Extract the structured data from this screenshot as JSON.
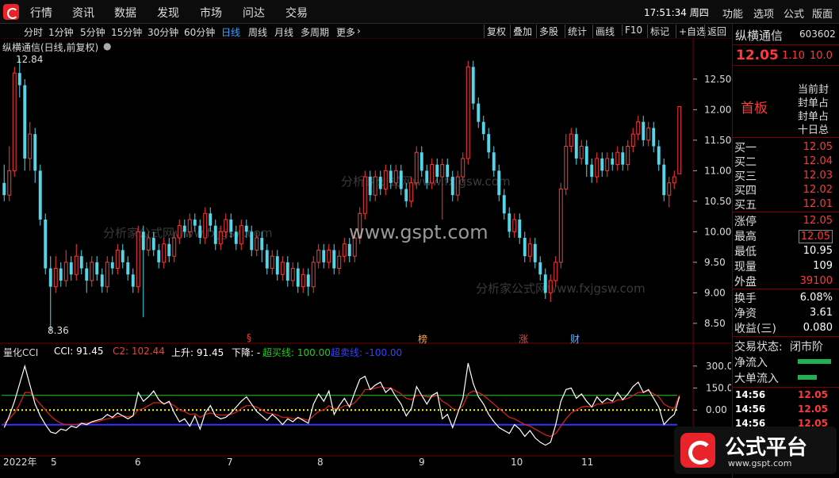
{
  "topbar": {
    "menus": [
      "行情",
      "资讯",
      "数据",
      "发现",
      "市场",
      "问达",
      "交易"
    ],
    "clock": "17:51:34 周四",
    "right_menus": [
      "功能",
      "选项",
      "公式",
      "版面"
    ]
  },
  "toolbar": {
    "periods": [
      "分时",
      "1分钟",
      "5分钟",
      "15分钟",
      "30分钟",
      "60分钟",
      "日线",
      "周线",
      "月线",
      "多周期",
      "更多"
    ],
    "active_period": "日线",
    "right_items": [
      "复权",
      "叠加",
      "多股",
      "统计",
      "画线",
      "F10",
      "标记",
      "+自选",
      "返回"
    ]
  },
  "main_chart": {
    "title": "纵横通信(日线,前复权)",
    "high_marker": "12.84",
    "low_marker": "8.36",
    "y_ticks": [
      "12.50",
      "12.00",
      "11.50",
      "11.00",
      "10.50",
      "10.00",
      "9.50",
      "9.00",
      "8.50"
    ],
    "event_tags": [
      "§",
      "榜",
      "涨",
      "财"
    ],
    "watermark": "www.gspt.com",
    "bg_watermark": "分析家公式网www.fxjgsw.com"
  },
  "indicator": {
    "name": "量化CCI",
    "cci_label": "CCI: 91.45",
    "c2_label": "C2: 102.44",
    "up_label": "上升: 91.45",
    "down_label": "下降: -",
    "overbuy_label": "超买线: 100.00",
    "oversell_label": "超卖线: -100.00",
    "y_ticks": [
      "300.0",
      "150.0",
      "0.00"
    ]
  },
  "x_axis": {
    "labels": [
      "2022年",
      "5",
      "6",
      "7",
      "8",
      "9",
      "10",
      "11"
    ]
  },
  "right_panel": {
    "stock_name": "纵横通信",
    "stock_code": "603602",
    "price": "12.05",
    "change": "1.10",
    "pct": "10.0",
    "tag": "首板",
    "notes": [
      "当前封",
      "封单占",
      "封单占",
      "十日总"
    ],
    "bids": [
      {
        "label": "买一",
        "value": "12.05"
      },
      {
        "label": "买二",
        "value": "12.04"
      },
      {
        "label": "买三",
        "value": "12.03"
      },
      {
        "label": "买四",
        "value": "12.02"
      },
      {
        "label": "买五",
        "value": "12.01"
      }
    ],
    "stats": [
      {
        "label": "涨停",
        "value": "12.05"
      },
      {
        "label": "最高",
        "value": "12.05"
      },
      {
        "label": "最低",
        "value": "10.95"
      },
      {
        "label": "现量",
        "value": "109"
      },
      {
        "label": "外盘",
        "value": "39100"
      }
    ],
    "stats2": [
      {
        "label": "换手",
        "value": "6.08%"
      },
      {
        "label": "净资",
        "value": "3.61"
      },
      {
        "label": "收益(三)",
        "value": "0.080"
      }
    ],
    "trade_status_label": "交易状态:",
    "trade_status": "闭市阶",
    "net_inflow": "净流入",
    "big_inflow": "大单流入",
    "ticks": [
      {
        "time": "14:56",
        "price": "12.05"
      },
      {
        "time": "14:56",
        "price": "12.05"
      },
      {
        "time": "14:56",
        "price": "12.05"
      }
    ]
  },
  "badge": {
    "title": "公式平台",
    "url": "www.gspt.com"
  },
  "colors": {
    "up": "#ff3a3a",
    "down": "#54d6e8",
    "cci": "#ffffff",
    "c2": "#e02020",
    "overbuy": "#22cc22",
    "oversell": "#3333ff",
    "zero": "#ffff00"
  },
  "chart_data": {
    "type": "candlestick",
    "title": "纵横通信(日线,前复权)",
    "ylim": [
      8.2,
      12.9
    ],
    "candles": [
      [
        10.8,
        10.6,
        11.1,
        10.5
      ],
      [
        10.6,
        11.0,
        11.4,
        10.5
      ],
      [
        11.0,
        12.6,
        12.7,
        10.9
      ],
      [
        12.6,
        12.4,
        12.84,
        12.2
      ],
      [
        12.4,
        11.2,
        12.5,
        11.0
      ],
      [
        11.2,
        11.6,
        11.8,
        11.0
      ],
      [
        11.6,
        11.0,
        11.7,
        10.8
      ],
      [
        11.0,
        10.2,
        11.1,
        10.1
      ],
      [
        10.2,
        9.4,
        10.3,
        9.3
      ],
      [
        9.4,
        9.1,
        9.6,
        8.36
      ],
      [
        9.1,
        9.4,
        9.6,
        9.0
      ],
      [
        9.4,
        9.2,
        9.5,
        9.1
      ],
      [
        9.2,
        9.5,
        9.7,
        9.1
      ],
      [
        9.5,
        9.3,
        9.6,
        9.2
      ],
      [
        9.3,
        9.6,
        9.8,
        9.2
      ],
      [
        9.6,
        9.4,
        9.7,
        9.3
      ],
      [
        9.4,
        9.2,
        9.5,
        9.0
      ],
      [
        9.2,
        9.5,
        9.6,
        9.1
      ],
      [
        9.5,
        9.3,
        9.6,
        9.2
      ],
      [
        9.3,
        9.1,
        9.4,
        9.0
      ],
      [
        9.1,
        9.5,
        9.6,
        9.0
      ],
      [
        9.5,
        9.4,
        9.6,
        9.3
      ],
      [
        9.4,
        9.7,
        9.8,
        9.3
      ],
      [
        9.7,
        9.5,
        9.8,
        9.4
      ],
      [
        9.5,
        9.3,
        9.6,
        9.2
      ],
      [
        9.3,
        9.1,
        9.4,
        9.0
      ],
      [
        9.1,
        10.0,
        10.1,
        9.0
      ],
      [
        10.0,
        9.7,
        10.1,
        8.6
      ],
      [
        9.7,
        9.9,
        10.0,
        9.6
      ],
      [
        9.9,
        9.7,
        10.0,
        9.6
      ],
      [
        9.7,
        9.5,
        9.8,
        9.4
      ],
      [
        9.5,
        9.8,
        9.9,
        9.4
      ],
      [
        9.8,
        9.6,
        9.9,
        9.5
      ],
      [
        9.6,
        9.9,
        10.0,
        9.5
      ],
      [
        9.9,
        10.1,
        10.2,
        9.8
      ],
      [
        10.1,
        10.0,
        10.2,
        9.9
      ],
      [
        10.0,
        10.2,
        10.3,
        9.9
      ],
      [
        10.2,
        10.1,
        10.3,
        10.0
      ],
      [
        10.1,
        9.9,
        10.2,
        9.8
      ],
      [
        9.9,
        10.3,
        10.4,
        9.8
      ],
      [
        10.3,
        10.1,
        10.4,
        10.0
      ],
      [
        10.1,
        9.8,
        10.2,
        9.7
      ],
      [
        9.8,
        10.0,
        10.1,
        9.7
      ],
      [
        10.0,
        10.2,
        10.3,
        9.9
      ],
      [
        10.2,
        10.0,
        10.3,
        9.9
      ],
      [
        10.0,
        9.8,
        10.1,
        9.7
      ],
      [
        9.8,
        10.1,
        10.2,
        9.7
      ],
      [
        10.1,
        10.0,
        10.2,
        9.9
      ],
      [
        10.0,
        9.7,
        10.1,
        9.6
      ],
      [
        9.7,
        9.9,
        10.0,
        9.6
      ],
      [
        9.9,
        9.7,
        10.0,
        9.5
      ],
      [
        9.7,
        9.4,
        9.8,
        9.3
      ],
      [
        9.4,
        9.6,
        9.7,
        9.3
      ],
      [
        9.6,
        9.3,
        9.7,
        9.2
      ],
      [
        9.3,
        9.5,
        9.6,
        9.2
      ],
      [
        9.5,
        9.2,
        9.6,
        9.1
      ],
      [
        9.2,
        9.4,
        9.5,
        9.1
      ],
      [
        9.4,
        9.1,
        9.5,
        9.0
      ],
      [
        9.1,
        9.3,
        9.4,
        9.0
      ],
      [
        9.3,
        9.1,
        9.4,
        8.95
      ],
      [
        9.1,
        9.5,
        9.6,
        9.0
      ],
      [
        9.5,
        9.7,
        9.8,
        9.4
      ],
      [
        9.7,
        9.5,
        9.8,
        9.4
      ],
      [
        9.5,
        9.7,
        9.8,
        9.4
      ],
      [
        9.7,
        9.4,
        9.8,
        9.3
      ],
      [
        9.4,
        9.6,
        9.7,
        9.3
      ],
      [
        9.6,
        9.8,
        9.9,
        9.5
      ],
      [
        9.8,
        9.6,
        9.9,
        9.5
      ],
      [
        9.6,
        9.9,
        10.0,
        9.5
      ],
      [
        9.9,
        10.3,
        10.4,
        9.8
      ],
      [
        10.3,
        10.9,
        11.0,
        10.2
      ],
      [
        10.9,
        10.6,
        11.0,
        10.5
      ],
      [
        10.6,
        10.9,
        11.0,
        10.5
      ],
      [
        10.9,
        10.7,
        11.0,
        10.6
      ],
      [
        10.7,
        11.0,
        11.1,
        10.6
      ],
      [
        11.0,
        10.8,
        11.1,
        10.7
      ],
      [
        10.8,
        11.0,
        11.1,
        10.7
      ],
      [
        11.0,
        10.7,
        11.1,
        10.6
      ],
      [
        10.7,
        10.5,
        10.8,
        10.4
      ],
      [
        10.5,
        10.8,
        10.9,
        10.4
      ],
      [
        10.8,
        11.3,
        11.4,
        10.7
      ],
      [
        11.3,
        11.0,
        11.4,
        10.9
      ],
      [
        11.0,
        10.8,
        11.1,
        10.7
      ],
      [
        10.8,
        11.1,
        11.2,
        10.7
      ],
      [
        11.1,
        10.9,
        11.2,
        10.8
      ],
      [
        10.9,
        11.1,
        11.2,
        10.2
      ],
      [
        11.1,
        10.9,
        11.2,
        10.8
      ],
      [
        10.9,
        10.6,
        11.0,
        10.5
      ],
      [
        10.6,
        10.9,
        11.0,
        10.5
      ],
      [
        10.9,
        11.2,
        11.3,
        10.8
      ],
      [
        11.2,
        12.7,
        12.8,
        11.1
      ],
      [
        12.7,
        12.1,
        12.8,
        12.0
      ],
      [
        12.1,
        11.8,
        12.2,
        11.7
      ],
      [
        11.8,
        11.6,
        11.9,
        11.5
      ],
      [
        11.6,
        11.3,
        11.7,
        11.2
      ],
      [
        11.3,
        11.0,
        11.4,
        10.9
      ],
      [
        11.0,
        10.6,
        11.1,
        10.5
      ],
      [
        10.6,
        10.3,
        10.7,
        10.2
      ],
      [
        10.3,
        10.0,
        10.4,
        9.9
      ],
      [
        10.0,
        10.2,
        10.3,
        9.9
      ],
      [
        10.2,
        9.9,
        10.3,
        9.8
      ],
      [
        9.9,
        9.6,
        10.0,
        9.5
      ],
      [
        9.6,
        9.8,
        9.9,
        9.5
      ],
      [
        9.8,
        9.5,
        9.9,
        9.4
      ],
      [
        9.5,
        9.3,
        9.6,
        9.2
      ],
      [
        9.3,
        9.0,
        9.4,
        8.9
      ],
      [
        9.0,
        9.2,
        9.3,
        8.85
      ],
      [
        9.2,
        9.5,
        9.6,
        9.1
      ],
      [
        9.5,
        10.7,
        10.8,
        9.4
      ],
      [
        10.7,
        11.4,
        11.6,
        10.6
      ],
      [
        11.4,
        11.6,
        11.7,
        11.3
      ],
      [
        11.6,
        11.2,
        11.7,
        11.1
      ],
      [
        11.2,
        11.4,
        11.5,
        11.1
      ],
      [
        11.4,
        11.1,
        11.5,
        10.9
      ],
      [
        11.1,
        10.9,
        11.2,
        10.8
      ],
      [
        10.9,
        11.2,
        11.3,
        10.8
      ],
      [
        11.2,
        11.0,
        11.3,
        10.9
      ],
      [
        11.0,
        11.2,
        11.3,
        10.9
      ],
      [
        11.2,
        11.1,
        11.3,
        11.0
      ],
      [
        11.1,
        11.3,
        11.4,
        11.0
      ],
      [
        11.3,
        11.1,
        11.4,
        11.0
      ],
      [
        11.1,
        11.4,
        11.5,
        11.0
      ],
      [
        11.4,
        11.6,
        11.7,
        11.3
      ],
      [
        11.6,
        11.8,
        11.9,
        11.5
      ],
      [
        11.8,
        11.5,
        11.9,
        11.4
      ],
      [
        11.5,
        11.7,
        11.8,
        11.4
      ],
      [
        11.7,
        11.4,
        11.8,
        11.3
      ],
      [
        11.4,
        11.1,
        11.5,
        11.0
      ],
      [
        11.1,
        10.6,
        11.2,
        10.5
      ],
      [
        10.6,
        10.8,
        10.9,
        10.4
      ],
      [
        10.8,
        10.9,
        11.0,
        10.7
      ],
      [
        10.95,
        12.05,
        12.05,
        10.95
      ]
    ],
    "indicator": {
      "name": "量化CCI",
      "ylim": [
        -280,
        380
      ],
      "overbuy": 100,
      "oversell": -100,
      "zero": 0,
      "cci": [
        -120,
        -40,
        60,
        180,
        300,
        170,
        40,
        -40,
        -100,
        -150,
        -160,
        -130,
        -140,
        -110,
        -120,
        -90,
        -100,
        -80,
        -70,
        -60,
        -30,
        -50,
        -20,
        -40,
        -60,
        -40,
        120,
        60,
        90,
        130,
        70,
        40,
        60,
        -20,
        -80,
        -60,
        -110,
        -40,
        -130,
        -20,
        30,
        -40,
        -60,
        -50,
        -20,
        20,
        60,
        90,
        40,
        -10,
        -40,
        -70,
        -30,
        -60,
        -100,
        -60,
        -80,
        -50,
        -70,
        -90,
        40,
        110,
        60,
        130,
        -30,
        30,
        80,
        20,
        120,
        210,
        230,
        140,
        170,
        190,
        120,
        150,
        90,
        40,
        -40,
        10,
        160,
        100,
        40,
        100,
        120,
        -60,
        -30,
        -120,
        -20,
        80,
        320,
        180,
        90,
        40,
        -30,
        -80,
        -120,
        -140,
        -160,
        -100,
        -130,
        -180,
        -140,
        -190,
        -220,
        -240,
        -220,
        -100,
        60,
        140,
        150,
        80,
        110,
        60,
        20,
        90,
        50,
        80,
        60,
        120,
        70,
        110,
        160,
        190,
        120,
        140,
        80,
        20,
        -100,
        -60,
        -30,
        91.45
      ],
      "c2": [
        -90,
        -60,
        -20,
        40,
        120,
        120,
        80,
        40,
        0,
        -40,
        -70,
        -90,
        -100,
        -100,
        -100,
        -90,
        -90,
        -85,
        -80,
        -70,
        -60,
        -55,
        -45,
        -40,
        -45,
        -40,
        0,
        10,
        30,
        50,
        50,
        45,
        50,
        30,
        0,
        -10,
        -30,
        -25,
        -50,
        -30,
        -20,
        -30,
        -35,
        -35,
        -30,
        -15,
        10,
        30,
        30,
        20,
        0,
        -20,
        -25,
        -35,
        -50,
        -50,
        -60,
        -55,
        -60,
        -70,
        -40,
        -10,
        0,
        30,
        10,
        10,
        30,
        30,
        50,
        90,
        140,
        140,
        150,
        160,
        150,
        150,
        130,
        110,
        80,
        70,
        100,
        100,
        90,
        90,
        100,
        60,
        40,
        10,
        0,
        30,
        110,
        130,
        120,
        100,
        70,
        40,
        10,
        -20,
        -50,
        -60,
        -80,
        -100,
        -110,
        -130,
        -150,
        -170,
        -180,
        -160,
        -110,
        -60,
        -20,
        0,
        20,
        25,
        20,
        40,
        40,
        50,
        50,
        70,
        70,
        80,
        100,
        120,
        120,
        130,
        110,
        90,
        40,
        20,
        10,
        102.44
      ]
    }
  }
}
